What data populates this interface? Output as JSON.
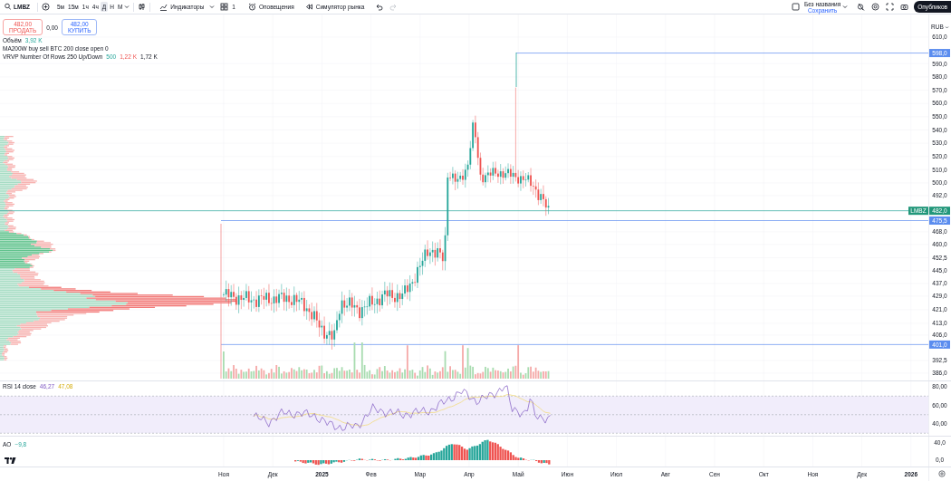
{
  "toolbar": {
    "symbol": "LMBZ",
    "timeframes": [
      {
        "label": "5м",
        "selected": false
      },
      {
        "label": "15м",
        "selected": false
      },
      {
        "label": "1ч",
        "selected": false
      },
      {
        "label": "4ч",
        "selected": false
      },
      {
        "label": "Д",
        "selected": true
      },
      {
        "label": "Н",
        "selected": false
      },
      {
        "label": "М",
        "selected": false
      }
    ],
    "indicators_label": "Индикаторы",
    "layout_count": "1",
    "alerts_label": "Оповещения",
    "replay_label": "Симулятор рынка",
    "redo_disabled": true,
    "layout_name": "Без названия",
    "save_label": "Сохранить",
    "publish_label": "Опубликов"
  },
  "order_panel": {
    "sell": {
      "price": "482,00",
      "label": "ПРОДАТЬ"
    },
    "spread": "0,00",
    "buy": {
      "price": "482,00",
      "label": "КУПИТЬ"
    }
  },
  "legend": [
    {
      "name": "Объём",
      "values": [
        {
          "text": "3,92 K",
          "kind": "up"
        }
      ]
    },
    {
      "name": "MA200W buy sell BTC 200 close open 0"
    },
    {
      "name": "VRVP Number Of Rows 250 Up/Down",
      "values": [
        {
          "text": "500",
          "kind": "up"
        },
        {
          "text": "1,22 K",
          "kind": "down"
        },
        {
          "text": "1,72 K",
          "kind": "total"
        }
      ]
    }
  ],
  "price_axis": {
    "currency": "RUB",
    "labels": [
      "610,0",
      "590,0",
      "580,0",
      "570,0",
      "560,0",
      "550,0",
      "540,0",
      "530,0",
      "520,0",
      "510,0",
      "500,0",
      "492,0",
      "468,0",
      "460,0",
      "452,5",
      "445,0",
      "437,0",
      "429,0",
      "421,0",
      "413,0",
      "406,0",
      "392,5",
      "386,0"
    ]
  },
  "price_tags": [
    {
      "kind": "level",
      "text": "598,0"
    },
    {
      "kind": "last",
      "symbol": "LMBZ",
      "text": "482,0"
    },
    {
      "kind": "level",
      "text": "475,5"
    },
    {
      "kind": "level",
      "text": "401,0"
    }
  ],
  "rsi": {
    "title": "RSI 14 close",
    "values": [
      {
        "text": "46,27",
        "kind": "rsi"
      },
      {
        "text": "47,08",
        "kind": "average"
      }
    ],
    "axis": [
      "80,00",
      "60,00",
      "40,00"
    ]
  },
  "ao": {
    "title": "AO",
    "value": "−9,8",
    "axis": [
      "40,0",
      "0,0"
    ]
  },
  "time_axis": [
    {
      "text": "Ноя",
      "kind": "month"
    },
    {
      "text": "Дек",
      "kind": "month"
    },
    {
      "text": "2025",
      "kind": "year"
    },
    {
      "text": "Фев",
      "kind": "month"
    },
    {
      "text": "Мар",
      "kind": "month"
    },
    {
      "text": "Апр",
      "kind": "month"
    },
    {
      "text": "Май",
      "kind": "month"
    },
    {
      "text": "Июн",
      "kind": "month"
    },
    {
      "text": "Июл",
      "kind": "month"
    },
    {
      "text": "Авг",
      "kind": "month"
    },
    {
      "text": "Сен",
      "kind": "month"
    },
    {
      "text": "Окт",
      "kind": "month"
    },
    {
      "text": "Ноя",
      "kind": "month"
    },
    {
      "text": "Дек",
      "kind": "month"
    },
    {
      "text": "2026",
      "kind": "year"
    }
  ]
}
